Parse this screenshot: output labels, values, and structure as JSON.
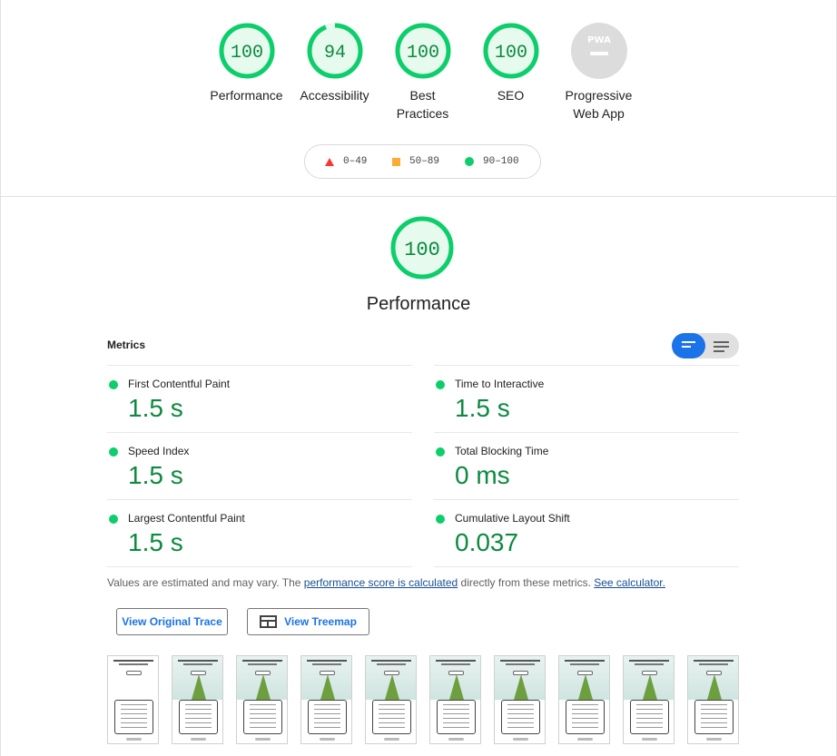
{
  "categories": [
    {
      "score": "100",
      "label": "Performance",
      "fraction": 1.0
    },
    {
      "score": "94",
      "label": "Accessibility",
      "fraction": 0.94
    },
    {
      "score": "100",
      "label": "Best Practices",
      "fraction": 1.0
    },
    {
      "score": "100",
      "label": "SEO",
      "fraction": 1.0
    },
    {
      "score": "PWA",
      "label": "Progressive Web App",
      "fraction": 0
    }
  ],
  "legend": {
    "fail": "0–49",
    "average": "50–89",
    "pass": "90–100"
  },
  "performance": {
    "score": "100",
    "fraction": 1.0,
    "title": "Performance",
    "metrics_heading": "Metrics",
    "metrics": [
      {
        "label": "First Contentful Paint",
        "value": "1.5 s"
      },
      {
        "label": "Time to Interactive",
        "value": "1.5 s"
      },
      {
        "label": "Speed Index",
        "value": "1.5 s"
      },
      {
        "label": "Total Blocking Time",
        "value": "0 ms"
      },
      {
        "label": "Largest Contentful Paint",
        "value": "1.5 s"
      },
      {
        "label": "Cumulative Layout Shift",
        "value": "0.037"
      }
    ],
    "note_prefix": "Values are estimated and may vary. The ",
    "note_link": "performance score is calculated",
    "note_middle": " directly from these metrics. ",
    "note_link2": "See calculator.",
    "buttons": {
      "trace": "View Original Trace",
      "treemap": "View Treemap"
    }
  },
  "colors": {
    "pass": "#0cce6b",
    "pass_text": "#0c8a3f",
    "average": "#ffaa33",
    "fail": "#ff3333",
    "accent": "#1a73e8"
  },
  "filmstrip_frame_count": 10
}
